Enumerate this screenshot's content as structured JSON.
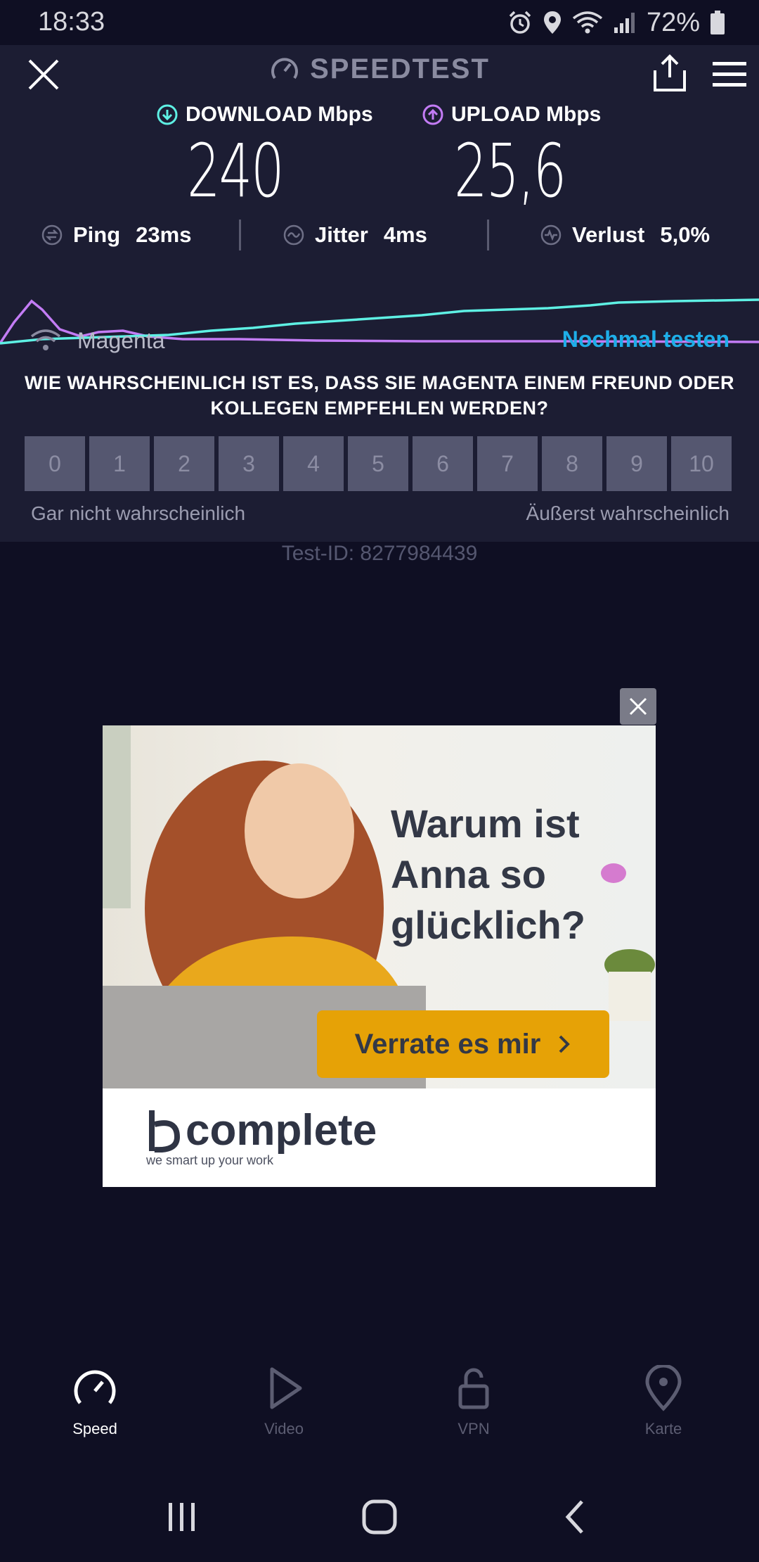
{
  "status_bar": {
    "time": "18:33",
    "battery": "72%"
  },
  "header": {
    "title": "SPEEDTEST"
  },
  "results": {
    "download": {
      "label": "DOWNLOAD Mbps",
      "value": "240"
    },
    "upload": {
      "label": "UPLOAD Mbps",
      "value": "25,6"
    },
    "ping": {
      "label": "Ping",
      "value": "23ms"
    },
    "jitter": {
      "label": "Jitter",
      "value": "4ms"
    },
    "loss": {
      "label": "Verlust",
      "value": "5,0%"
    }
  },
  "network": {
    "name": "Magenta",
    "retest": "Nochmal testen"
  },
  "survey": {
    "question": "WIE WAHRSCHEINLICH IST ES, DASS SIE MAGENTA EINEM FREUND ODER KOLLEGEN EMPFEHLEN WERDEN?",
    "options": [
      "0",
      "1",
      "2",
      "3",
      "4",
      "5",
      "6",
      "7",
      "8",
      "9",
      "10"
    ],
    "low_label": "Gar nicht wahrscheinlich",
    "high_label": "Äußerst wahrscheinlich"
  },
  "test_id": "Test-ID: 8277984439",
  "ad": {
    "headline": "Warum ist Anna so glücklich?",
    "cta": "Verrate es mir",
    "brand": "complete",
    "tagline": "we smart up your work"
  },
  "bottom_nav": [
    {
      "label": "Speed",
      "icon": "speedometer-icon",
      "active": true
    },
    {
      "label": "Video",
      "icon": "play-icon",
      "active": false
    },
    {
      "label": "VPN",
      "icon": "unlock-icon",
      "active": false
    },
    {
      "label": "Karte",
      "icon": "map-pin-icon",
      "active": false
    }
  ],
  "colors": {
    "download": "#5ef0e4",
    "upload": "#c37cf5",
    "accent": "#1eaee8",
    "cta": "#e6a206"
  }
}
